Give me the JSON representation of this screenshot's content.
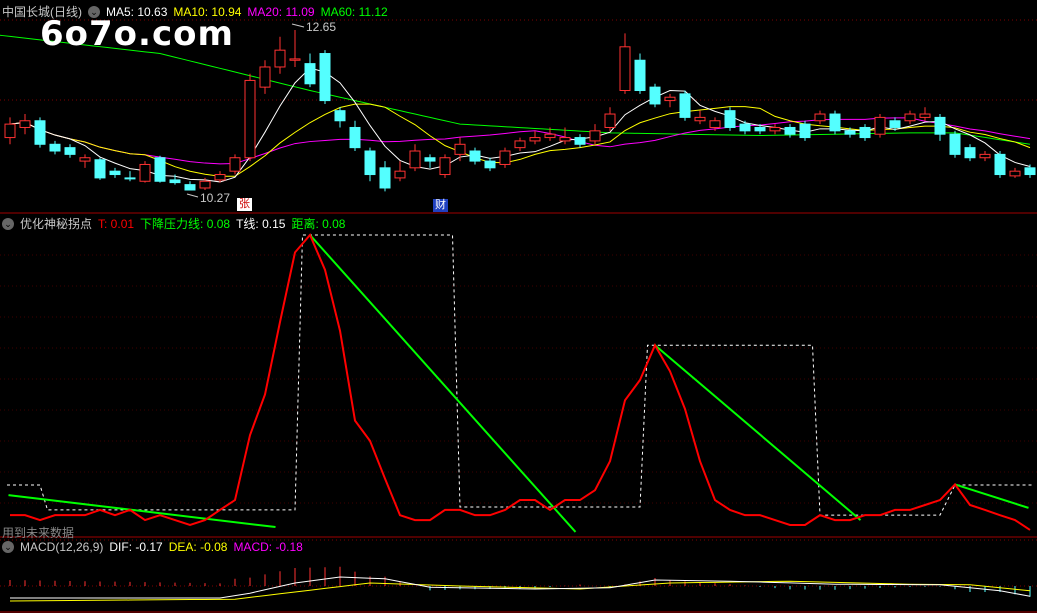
{
  "main_panel": {
    "stock_name": "中国长城(日线)",
    "ma5_label": "MA5: 10.63",
    "ma10_label": "MA10: 10.94",
    "ma20_label": "MA20: 11.09",
    "ma60_label": "MA60: 11.12",
    "high_label": "12.65",
    "low_label": "10.27",
    "badge_zhang": "张",
    "badge_cai": "财",
    "colors": {
      "up": "#ff3232",
      "down": "#54ffff",
      "ma5": "#ffffff",
      "ma10": "#ffff00",
      "ma20": "#ff00ff",
      "ma60": "#00ff00"
    },
    "candles": [
      [
        11.05,
        11.25,
        11.35,
        10.95
      ],
      [
        11.2,
        11.3,
        11.4,
        11.1
      ],
      [
        11.3,
        10.95,
        11.35,
        10.9
      ],
      [
        10.95,
        10.85,
        11.0,
        10.8
      ],
      [
        10.9,
        10.8,
        10.95,
        10.75
      ],
      [
        10.7,
        10.75,
        10.8,
        10.6
      ],
      [
        10.72,
        10.45,
        10.75,
        10.42
      ],
      [
        10.55,
        10.5,
        10.6,
        10.45
      ],
      [
        10.45,
        10.44,
        10.55,
        10.4
      ],
      [
        10.4,
        10.65,
        10.7,
        10.38
      ],
      [
        10.75,
        10.4,
        10.78,
        10.38
      ],
      [
        10.42,
        10.38,
        10.5,
        10.35
      ],
      [
        10.35,
        10.27,
        10.4,
        10.27
      ],
      [
        10.3,
        10.4,
        10.45,
        10.27
      ],
      [
        10.42,
        10.5,
        10.55,
        10.38
      ],
      [
        10.55,
        10.75,
        10.8,
        10.5
      ],
      [
        10.75,
        11.9,
        12.0,
        10.7
      ],
      [
        11.8,
        12.1,
        12.2,
        11.7
      ],
      [
        12.1,
        12.35,
        12.55,
        12.0
      ],
      [
        12.2,
        12.22,
        12.65,
        12.1
      ],
      [
        12.15,
        11.85,
        12.3,
        11.8
      ],
      [
        12.3,
        11.6,
        12.35,
        11.55
      ],
      [
        11.45,
        11.3,
        11.5,
        11.2
      ],
      [
        11.2,
        10.9,
        11.3,
        10.85
      ],
      [
        10.85,
        10.5,
        10.9,
        10.4
      ],
      [
        10.6,
        10.3,
        10.7,
        10.25
      ],
      [
        10.45,
        10.55,
        10.7,
        10.4
      ],
      [
        10.6,
        10.85,
        10.95,
        10.55
      ],
      [
        10.75,
        10.7,
        10.8,
        10.6
      ],
      [
        10.5,
        10.75,
        10.8,
        10.45
      ],
      [
        10.8,
        10.95,
        11.05,
        10.7
      ],
      [
        10.85,
        10.7,
        10.9,
        10.65
      ],
      [
        10.7,
        10.6,
        10.75,
        10.55
      ],
      [
        10.65,
        10.85,
        10.9,
        10.6
      ],
      [
        10.9,
        11.0,
        11.05,
        10.85
      ],
      [
        11.0,
        11.05,
        11.15,
        10.95
      ],
      [
        11.05,
        11.1,
        11.2,
        11.0
      ],
      [
        11.0,
        11.05,
        11.2,
        10.95
      ],
      [
        11.05,
        10.95,
        11.1,
        10.9
      ],
      [
        11.0,
        11.15,
        11.25,
        10.95
      ],
      [
        11.2,
        11.4,
        11.5,
        11.15
      ],
      [
        11.75,
        12.4,
        12.6,
        11.7
      ],
      [
        12.2,
        11.75,
        12.3,
        11.7
      ],
      [
        11.8,
        11.55,
        11.85,
        11.5
      ],
      [
        11.6,
        11.65,
        11.7,
        11.5
      ],
      [
        11.7,
        11.35,
        11.75,
        11.3
      ],
      [
        11.3,
        11.35,
        11.45,
        11.25
      ],
      [
        11.2,
        11.3,
        11.35,
        11.15
      ],
      [
        11.45,
        11.2,
        11.5,
        11.15
      ],
      [
        11.25,
        11.15,
        11.3,
        11.1
      ],
      [
        11.2,
        11.15,
        11.25,
        11.1
      ],
      [
        11.15,
        11.2,
        11.25,
        11.1
      ],
      [
        11.2,
        11.1,
        11.25,
        11.05
      ],
      [
        11.25,
        11.05,
        11.3,
        11.0
      ],
      [
        11.3,
        11.4,
        11.45,
        11.25
      ],
      [
        11.4,
        11.15,
        11.45,
        11.1
      ],
      [
        11.15,
        11.1,
        11.2,
        11.05
      ],
      [
        11.2,
        11.05,
        11.25,
        11.0
      ],
      [
        11.1,
        11.35,
        11.4,
        11.05
      ],
      [
        11.3,
        11.2,
        11.35,
        11.15
      ],
      [
        11.3,
        11.4,
        11.45,
        11.25
      ],
      [
        11.35,
        11.4,
        11.5,
        11.3
      ],
      [
        11.35,
        11.1,
        11.4,
        11.0
      ],
      [
        11.1,
        10.8,
        11.15,
        10.75
      ],
      [
        10.9,
        10.75,
        10.95,
        10.7
      ],
      [
        10.75,
        10.8,
        10.85,
        10.7
      ],
      [
        10.8,
        10.5,
        10.85,
        10.45
      ],
      [
        10.48,
        10.55,
        10.6,
        10.45
      ],
      [
        10.6,
        10.5,
        10.65,
        10.45
      ]
    ],
    "ma60_keypoints": [
      [
        -1,
        12.58
      ],
      [
        10,
        12.3
      ],
      [
        20,
        11.75
      ],
      [
        30,
        11.25
      ],
      [
        40,
        11.12
      ],
      [
        50,
        11.08
      ],
      [
        60,
        11.12
      ],
      [
        63,
        11.12
      ],
      [
        68,
        10.95
      ]
    ]
  },
  "indicator_panel": {
    "title": "优化神秘拐点",
    "t_label": "T: 0.01",
    "pressure_label": "下降压力线: 0.08",
    "tline_label": "T线: 0.15",
    "distance_label": "距离: 0.08",
    "future_warning": "用到未来数据",
    "t_values": [
      3.4,
      3.4,
      1.7,
      3.4,
      3.4,
      3.4,
      5.2,
      3.4,
      5.2,
      1.7,
      3.4,
      1.7,
      0,
      1.7,
      5.2,
      8.6,
      31,
      45,
      70,
      94,
      100,
      88,
      67,
      36,
      29,
      16,
      3.4,
      1.7,
      1.7,
      5.2,
      5.2,
      3.4,
      3.4,
      5.2,
      8.6,
      8.6,
      5.2,
      8.6,
      8.6,
      12,
      22,
      43,
      50,
      62,
      53,
      40,
      22,
      8.6,
      5.2,
      3.4,
      3.4,
      1.7,
      0,
      0,
      3.4,
      1.7,
      1.7,
      3.4,
      3.4,
      5.2,
      5.2,
      6.9,
      8.6,
      14,
      6.9,
      5.2,
      3.4,
      1.7,
      -1.7
    ],
    "step_keypoints": [
      [
        -0.2,
        13.8
      ],
      [
        2,
        13.8
      ],
      [
        2.5,
        5.2
      ],
      [
        19,
        5.2
      ],
      [
        19.5,
        100
      ],
      [
        29.5,
        100
      ],
      [
        30,
        6.2
      ],
      [
        42,
        6.2
      ],
      [
        42.5,
        62
      ],
      [
        53.5,
        62
      ],
      [
        54,
        3.4
      ],
      [
        62,
        3.4
      ],
      [
        63,
        13.8
      ],
      [
        68.2,
        13.8
      ]
    ],
    "pressure_segments": [
      [
        [
          -0.1,
          10.3
        ],
        [
          17.7,
          -0.7
        ]
      ],
      [
        [
          20,
          100
        ],
        [
          37.7,
          -2.4
        ]
      ],
      [
        [
          43,
          62
        ],
        [
          56.7,
          1.7
        ]
      ],
      [
        [
          63,
          14
        ],
        [
          67.9,
          5.9
        ]
      ]
    ]
  },
  "macd_panel": {
    "title": "MACD(12,26,9)",
    "dif_label": "DIF: -0.17",
    "dea_label": "DEA: -0.08",
    "macd_label": "MACD: -0.18",
    "dif_keypoints": [
      [
        0,
        -0.2
      ],
      [
        14,
        -0.2
      ],
      [
        16,
        -0.12
      ],
      [
        19,
        0.05
      ],
      [
        22,
        0.15
      ],
      [
        25,
        0.12
      ],
      [
        28,
        -0.02
      ],
      [
        35,
        -0.05
      ],
      [
        40,
        -0.03
      ],
      [
        43,
        0.1
      ],
      [
        48,
        0.08
      ],
      [
        55,
        0.03
      ],
      [
        62,
        0.02
      ],
      [
        66,
        -0.08
      ],
      [
        68,
        -0.17
      ]
    ],
    "dea_keypoints": [
      [
        0,
        -0.25
      ],
      [
        15,
        -0.22
      ],
      [
        19,
        -0.1
      ],
      [
        24,
        0.05
      ],
      [
        30,
        0.0
      ],
      [
        38,
        -0.05
      ],
      [
        44,
        0.05
      ],
      [
        52,
        0.08
      ],
      [
        60,
        0.03
      ],
      [
        64,
        0.02
      ],
      [
        68,
        -0.08
      ]
    ]
  },
  "watermark": "6o7o.com"
}
